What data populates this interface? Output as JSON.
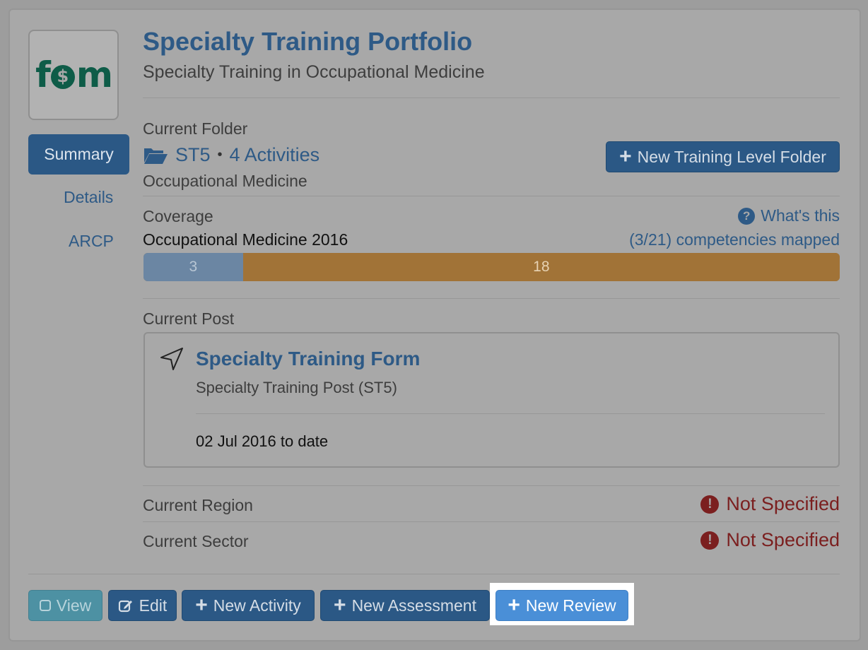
{
  "sidebar": {
    "logo_text": "fom",
    "items": [
      {
        "label": "Summary",
        "active": true
      },
      {
        "label": "Details",
        "active": false
      },
      {
        "label": "ARCP",
        "active": false
      }
    ]
  },
  "header": {
    "title": "Specialty Training Portfolio",
    "subtitle": "Specialty Training in Occupational Medicine"
  },
  "folder": {
    "label": "Current Folder",
    "name": "ST5",
    "separator": "•",
    "activities": "4 Activities",
    "specialty": "Occupational Medicine",
    "new_button": "New Training Level Folder",
    "icon": "folder-open-icon"
  },
  "coverage": {
    "label": "Coverage",
    "whats_this": "What's this",
    "curriculum": "Occupational Medicine 2016",
    "mapped_text": "(3/21) competencies mapped",
    "mapped": 3,
    "unmapped": 18,
    "total": 21,
    "colors": {
      "mapped": "#6b86a3",
      "unmapped": "#a17337"
    }
  },
  "post": {
    "label": "Current Post",
    "title": "Specialty Training Form",
    "subtitle": "Specialty Training Post (ST5)",
    "date_range": "02 Jul 2016 to date",
    "icon": "location-arrow-icon"
  },
  "region": {
    "label": "Current Region",
    "value": "Not Specified"
  },
  "sector": {
    "label": "Current Sector",
    "value": "Not Specified"
  },
  "actions": {
    "view": "View",
    "edit": "Edit",
    "new_activity": "New Activity",
    "new_assessment": "New Assessment",
    "new_review": "New Review"
  },
  "colors": {
    "primary": "#2b5885",
    "link": "#2e5a86",
    "danger": "#7b1f1f",
    "highlight_button": "#4a8fd7"
  }
}
